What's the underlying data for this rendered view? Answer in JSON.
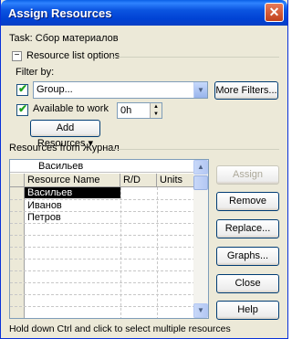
{
  "window": {
    "title": "Assign Resources",
    "close_glyph": "✕"
  },
  "task": {
    "label": "Task:",
    "value": "Сбор материалов"
  },
  "resource_list_options": {
    "toggle_glyph": "−",
    "label": "Resource list options"
  },
  "filter": {
    "label": "Filter by:",
    "checked": true,
    "selected": "Group...",
    "more_filters_label": "More Filters..."
  },
  "available_to_work": {
    "checked": true,
    "label": "Available to work",
    "value": "0h"
  },
  "add_resources": {
    "label": "Add Resources",
    "arrow_glyph": "▾"
  },
  "resources_from": {
    "label": "Resources from Журнал"
  },
  "grid": {
    "edit_value": "Васильев",
    "columns": [
      "Resource Name",
      "R/D",
      "Units"
    ],
    "rows": [
      {
        "name": "Васильев",
        "selected": true
      },
      {
        "name": "Иванов",
        "selected": false
      },
      {
        "name": "Петров",
        "selected": false
      }
    ]
  },
  "buttons": {
    "assign": "Assign",
    "remove": "Remove",
    "replace": "Replace...",
    "graphs": "Graphs...",
    "close": "Close",
    "help": "Help"
  },
  "status": {
    "hint": "Hold down Ctrl and click to select multiple resources"
  },
  "colors": {
    "title_bar": "#0a5fe6",
    "dialog_bg": "#ece9d8",
    "selection": "#000000",
    "check_green": "#21a121"
  }
}
